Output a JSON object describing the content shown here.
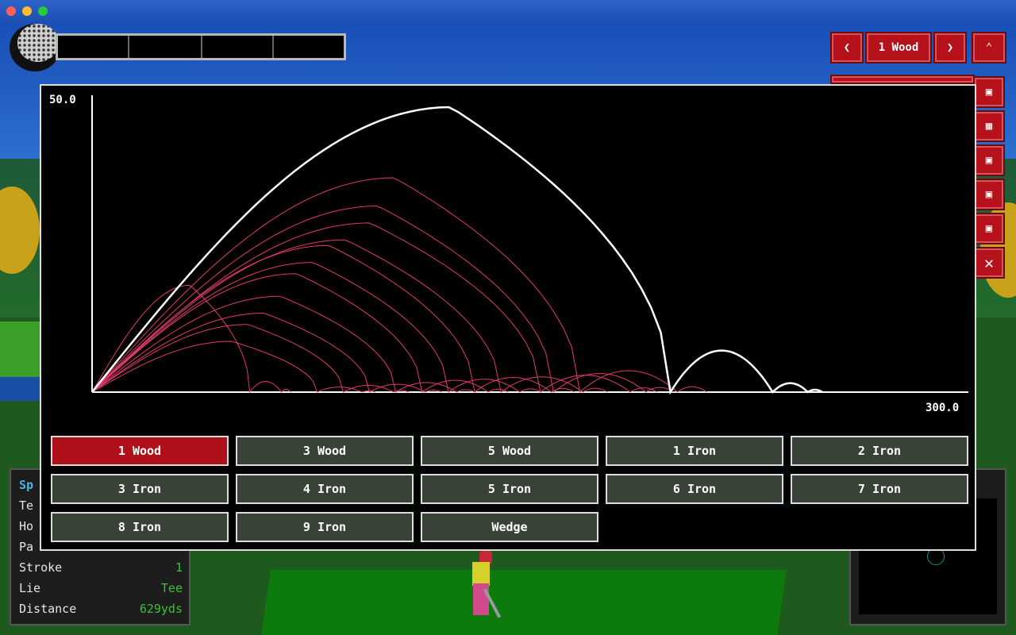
{
  "hud": {
    "club_label": "1 Wood",
    "prev_icon": "chevron-left-icon",
    "next_icon": "chevron-right-icon",
    "collapse_icon": "chevron-up-icon"
  },
  "stats": {
    "title_partial": "Sp",
    "rows": [
      {
        "label": "Te",
        "value": ""
      },
      {
        "label": "Ho",
        "value": ""
      },
      {
        "label": "Pa",
        "value": ""
      },
      {
        "label": "Stroke",
        "value": "1"
      },
      {
        "label": "Lie",
        "value": "Tee"
      },
      {
        "label": "Distance",
        "value": "629yds"
      }
    ]
  },
  "chart": {
    "y_max_label": "50.0",
    "x_max_label": "300.0",
    "highlight_color": "#ffffff",
    "series_color": "#e23a6a"
  },
  "chart_data": {
    "type": "line",
    "title": "",
    "xlabel": "",
    "ylabel": "",
    "xlim": [
      0,
      300
    ],
    "ylim": [
      0,
      50
    ],
    "x_tick_labels": [
      "300.0"
    ],
    "y_tick_labels": [
      "50.0"
    ],
    "highlighted_series": "1 Wood",
    "series": [
      {
        "name": "1 Wood",
        "carry": 198,
        "apex": 48,
        "bounces": [
          [
            198,
            233,
            7
          ],
          [
            233,
            245,
            1.5
          ],
          [
            245,
            250,
            0.4
          ]
        ]
      }
    ]
  },
  "clubs": {
    "selected": "1 Wood",
    "labels": [
      "1 Wood",
      "3 Wood",
      "5 Wood",
      "1 Iron",
      "2 Iron",
      "3 Iron",
      "4 Iron",
      "5 Iron",
      "6 Iron",
      "7 Iron",
      "8 Iron",
      "9 Iron",
      "Wedge"
    ]
  },
  "colors": {
    "accent": "#b0101a",
    "button": "#394237",
    "stat_value": "#39c239"
  }
}
